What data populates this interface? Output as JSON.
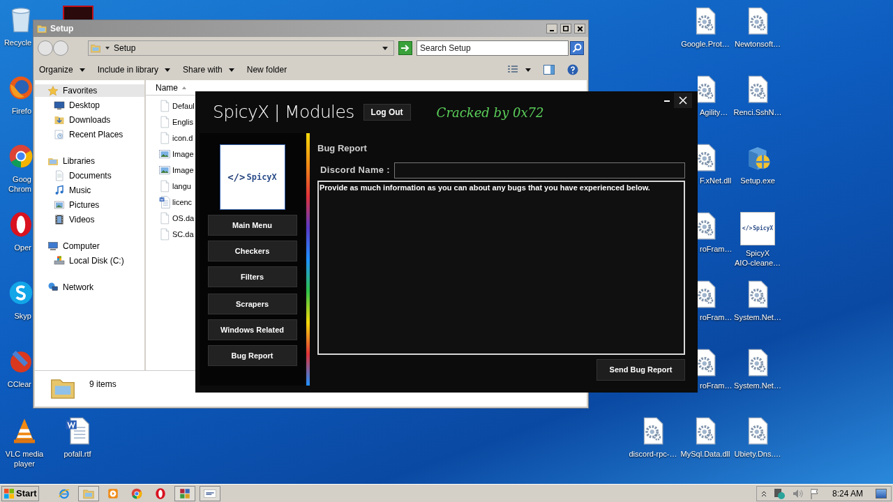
{
  "explorer": {
    "title": "Setup",
    "address": "Setup",
    "search": {
      "placeholder": "Search Setup"
    },
    "toolbar": [
      {
        "label": "Organize",
        "dropdown": true
      },
      {
        "label": "Include in library",
        "dropdown": true
      },
      {
        "label": "Share with",
        "dropdown": true
      },
      {
        "label": "New folder",
        "dropdown": false
      }
    ],
    "nav": [
      {
        "label": "Favorites",
        "selected": true,
        "children": [
          {
            "label": "Desktop",
            "selected": false
          },
          {
            "label": "Downloads",
            "selected": false
          },
          {
            "label": "Recent Places",
            "selected": false
          }
        ]
      },
      {
        "label": "Libraries",
        "selected": false,
        "children": [
          {
            "label": "Documents",
            "selected": false
          },
          {
            "label": "Music",
            "selected": false
          },
          {
            "label": "Pictures",
            "selected": false
          },
          {
            "label": "Videos",
            "selected": false
          }
        ]
      },
      {
        "label": "Computer",
        "selected": false,
        "children": [
          {
            "label": "Local Disk (C:)",
            "selected": false
          }
        ]
      },
      {
        "label": "Network",
        "selected": false
      }
    ],
    "columns": [
      "Name"
    ],
    "files": [
      {
        "name": "Defaul",
        "kind": "blank"
      },
      {
        "name": "Englis",
        "kind": "blank"
      },
      {
        "name": "icon.d",
        "kind": "blank"
      },
      {
        "name": "Image",
        "kind": "image"
      },
      {
        "name": "Image",
        "kind": "image"
      },
      {
        "name": "langu",
        "kind": "blank"
      },
      {
        "name": "licenc",
        "kind": "word"
      },
      {
        "name": "OS.da",
        "kind": "blank"
      },
      {
        "name": "SC.da",
        "kind": "blank"
      }
    ],
    "status": "9 items"
  },
  "app": {
    "title": "SpicyX | Modules",
    "logout": "Log Out",
    "cracked": "Cracked by 0x72",
    "logo_mark": "</>",
    "logo_name": "SpicyX",
    "nav": [
      "Main Menu",
      "Checkers",
      "Filters",
      "Scrapers",
      "Windows Related",
      "Bug Report"
    ],
    "section": "Bug Report",
    "discord_label": "Discord Name :",
    "details": {
      "value": "Provide as much information as you can about any bugs that you have experienced below."
    },
    "send": "Send Bug Report"
  },
  "desktop_icons": [
    {
      "label": "Recycle",
      "kind": "recycle"
    },
    {
      "label": "Firefo",
      "kind": "firefox"
    },
    {
      "label": "Goog\nChrom",
      "kind": "chrome"
    },
    {
      "label": "Oper",
      "kind": "opera"
    },
    {
      "label": "Skyp",
      "kind": "skype"
    },
    {
      "label": "CClear",
      "kind": "ccleaner"
    },
    {
      "label": "VLC media\nplayer",
      "kind": "vlc"
    },
    {
      "label": "pofall.rtf",
      "kind": "word"
    },
    {
      "label": "Google.Prot…",
      "kind": "gearfile"
    },
    {
      "label": "Newtonsoft…",
      "kind": "gearfile"
    },
    {
      "label": "Agility…",
      "kind": "gearfile"
    },
    {
      "label": "Renci.SshN…",
      "kind": "gearfile"
    },
    {
      "label": "F.xNet.dll",
      "kind": "gearfile"
    },
    {
      "label": "Setup.exe",
      "kind": "setup"
    },
    {
      "label": "roFram…",
      "kind": "gearfile"
    },
    {
      "label": "SpicyX\nAIO-cleane…",
      "kind": "spicyx",
      "thumb_mark": "</>",
      "thumb_name": "SpicyX"
    },
    {
      "label": "roFram…",
      "kind": "gearfile"
    },
    {
      "label": "System.Net…",
      "kind": "gearfile"
    },
    {
      "label": "roFram…",
      "kind": "gearfile"
    },
    {
      "label": "System.Net…",
      "kind": "gearfile"
    },
    {
      "label": "discord-rpc-…",
      "kind": "gearfile"
    },
    {
      "label": "MySql.Data.dll",
      "kind": "gearfile"
    },
    {
      "label": "Ubiety.Dns.…",
      "kind": "gearfile"
    }
  ],
  "taskbar": {
    "start": "Start",
    "apps": [
      {
        "kind": "ie"
      },
      {
        "kind": "folder"
      },
      {
        "kind": "media"
      },
      {
        "kind": "chrome"
      },
      {
        "kind": "opera"
      },
      {
        "kind": "winrar"
      },
      {
        "kind": "spicyx"
      }
    ],
    "clock": "8:24 AM"
  }
}
